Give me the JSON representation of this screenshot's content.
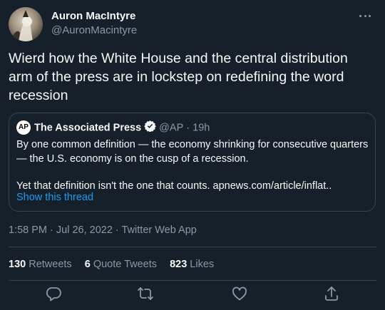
{
  "author": {
    "name": "Auron MacIntyre",
    "handle": "@AuronMacintyre"
  },
  "tweet": {
    "text": "Wierd how the White House and the central distribution arm of the press are in lockstep on redefining the word recession"
  },
  "quote": {
    "logo_text": "AP",
    "name": "The Associated Press",
    "handle": "@AP",
    "separator": "·",
    "time": "19h",
    "paragraph1": "By one common definition — the economy shrinking for consecutive quarters — the U.S. economy is on the cusp of a recession.",
    "paragraph2_text": "Yet that definition isn't the one that counts. ",
    "paragraph2_link": "apnews.com/article/inflat..",
    "show_thread": "Show this thread"
  },
  "meta": {
    "text": "1:58 PM · Jul 26, 2022 · Twitter Web App"
  },
  "stats": {
    "retweets_count": "130",
    "retweets_label": "Retweets",
    "quotes_count": "6",
    "quotes_label": "Quote Tweets",
    "likes_count": "823",
    "likes_label": "Likes"
  },
  "icons": {
    "more": "more-icon",
    "verified": "verified-badge-icon",
    "reply": "reply-icon",
    "retweet": "retweet-icon",
    "like": "like-icon",
    "share": "share-icon"
  },
  "colors": {
    "background": "#15202b",
    "text": "#f7f9f9",
    "secondary": "#8b98a5",
    "accent": "#1d9bf0",
    "border": "#38444d"
  }
}
